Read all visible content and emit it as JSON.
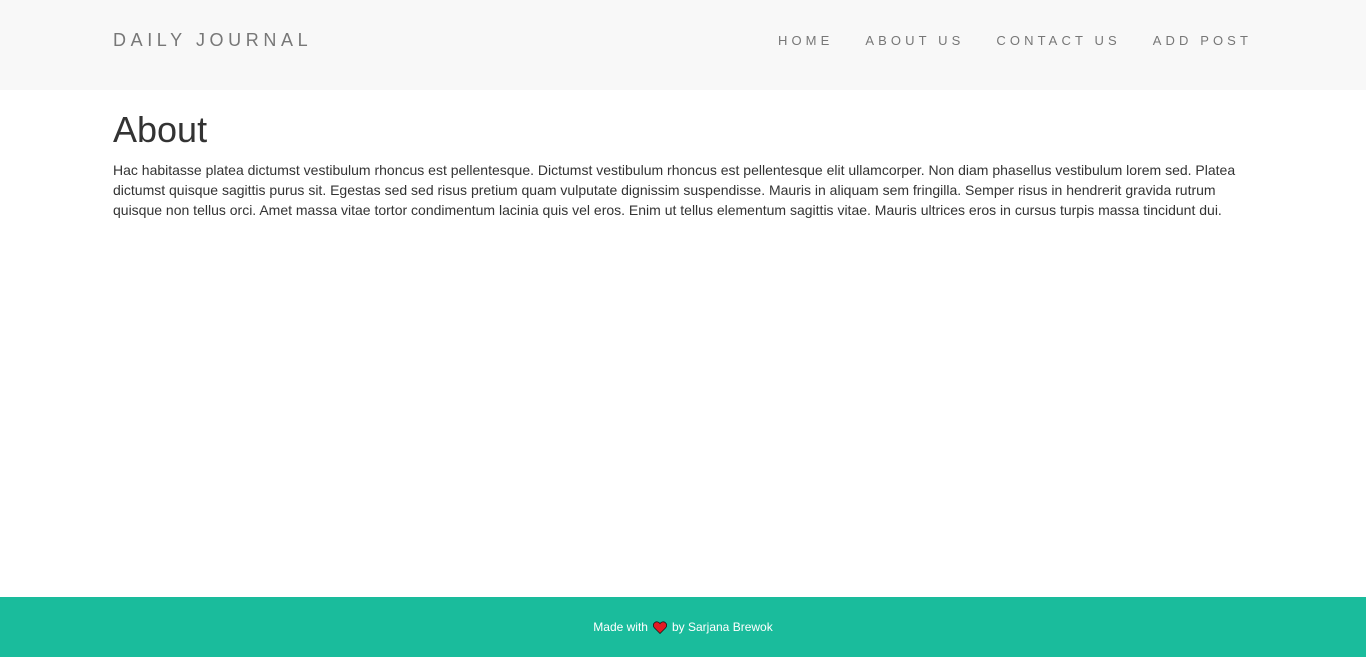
{
  "brand": "DAILY JOURNAL",
  "nav": {
    "home": "HOME",
    "about": "ABOUT US",
    "contact": "CONTACT US",
    "add_post": "ADD POST"
  },
  "page": {
    "title": "About",
    "body": "Hac habitasse platea dictumst vestibulum rhoncus est pellentesque. Dictumst vestibulum rhoncus est pellentesque elit ullamcorper. Non diam phasellus vestibulum lorem sed. Platea dictumst quisque sagittis purus sit. Egestas sed sed risus pretium quam vulputate dignissim suspendisse. Mauris in aliquam sem fringilla. Semper risus in hendrerit gravida rutrum quisque non tellus orci. Amet massa vitae tortor condimentum lacinia quis vel eros. Enim ut tellus elementum sagittis vitae. Mauris ultrices eros in cursus turpis massa tincidunt dui."
  },
  "footer": {
    "made_with": "Made with",
    "by": "by Sarjana Brewok",
    "icon": "heart-icon"
  },
  "colors": {
    "navbar_bg": "#f8f8f8",
    "footer_bg": "#1abc9c",
    "heart": "#e31b23",
    "nav_text": "#777777"
  }
}
